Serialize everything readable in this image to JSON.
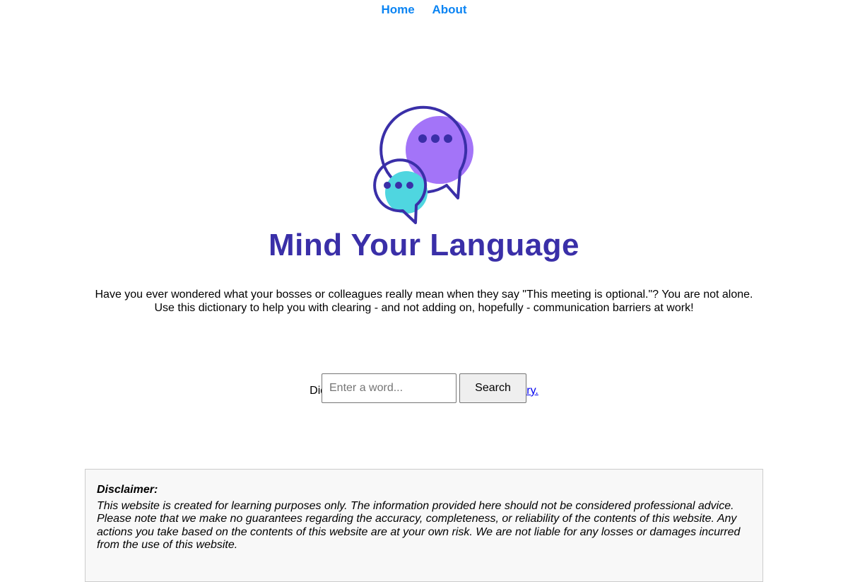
{
  "nav": {
    "items": [
      {
        "label": "Home"
      },
      {
        "label": "About"
      }
    ],
    "link_color": "#0b84f3"
  },
  "logo": {
    "text": "Mind Your Language",
    "icon": "speech-bubbles-icon",
    "colors": {
      "outline": "#3a2fa8",
      "purple": "#a374f8",
      "teal": "#4fd6e0"
    }
  },
  "intro": {
    "line1": "Have you ever wondered what your bosses or colleagues really mean when they say \"This meeting is optional.\"? You are not alone.",
    "line2": "Use this dictionary to help you with clearing - and not adding on, hopefully - communication barriers at work!"
  },
  "search": {
    "placeholder": "Enter a word...",
    "value": "",
    "button_label": "Search"
  },
  "suggest": {
    "prefix": "Didn't find ",
    "link_text": "new entry."
  },
  "disclaimer": {
    "title": "Disclaimer:",
    "body": "This website is created for learning purposes only. The information provided here should not be considered professional advice. Please note that we make no guarantees regarding the accuracy, completeness, or reliability of the contents of this website. Any actions you take based on the contents of this website are at your own risk. We are not liable for any losses or damages incurred from the use of this website."
  }
}
